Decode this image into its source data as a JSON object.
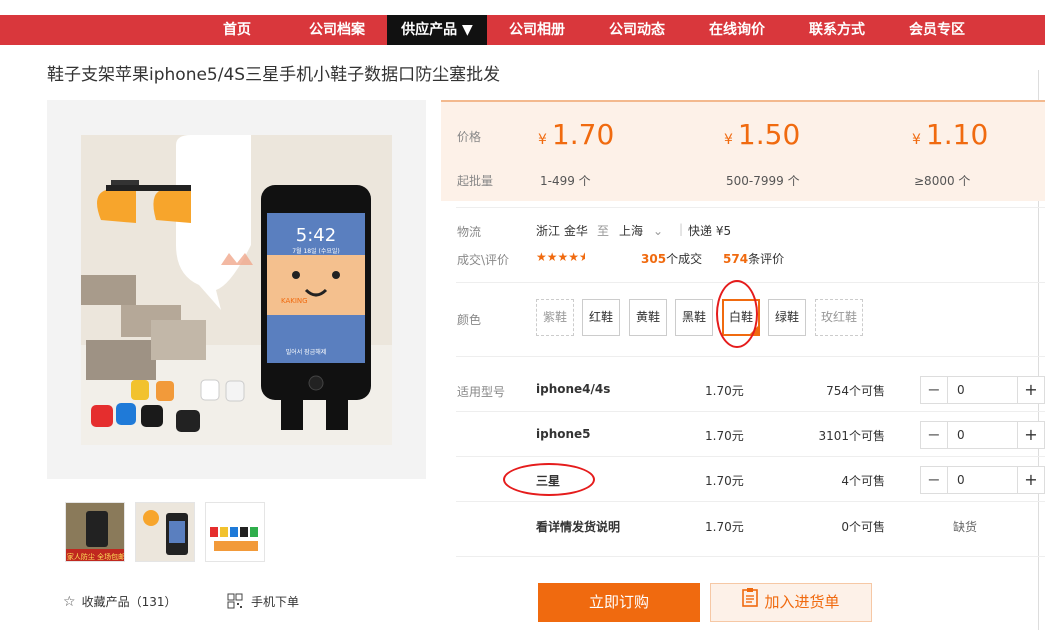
{
  "nav": {
    "items": [
      "首页",
      "公司档案",
      "供应产品 ▼",
      "公司相册",
      "公司动态",
      "在线询价",
      "联系方式",
      "会员专区"
    ]
  },
  "title": "鞋子支架苹果iphone5/4S三星手机小鞋子数据口防尘塞批发",
  "gallery": {
    "phone_time": "5:42",
    "phone_date": "7월 18일 (수요일)",
    "phone_slider": "밀어서 잠금해제",
    "watermark": "KAKING"
  },
  "thumb_caption": "家人防尘 全场包邮",
  "favorite": {
    "label": "收藏产品（131）"
  },
  "mobile_order": {
    "label": "手机下单"
  },
  "price": {
    "label": "价格",
    "qty_label": "起批量",
    "currency": "¥",
    "tiers": [
      {
        "price": "1.70",
        "qty": "1-499 个"
      },
      {
        "price": "1.50",
        "qty": "500-7999 个"
      },
      {
        "price": "1.10",
        "qty": "≥8000 个"
      }
    ]
  },
  "logistics": {
    "label": "物流",
    "from": "浙江 金华",
    "to_word": "至",
    "to": "上海",
    "express": "快递 ¥5"
  },
  "rating": {
    "label": "成交\\评价",
    "deals_num": "305",
    "deals_unit": "个成交",
    "reviews_num": "574",
    "reviews_unit": "条评价"
  },
  "colors": {
    "label": "颜色",
    "options": [
      {
        "name": "紫鞋",
        "state": "disabled"
      },
      {
        "name": "红鞋",
        "state": "normal"
      },
      {
        "name": "黄鞋",
        "state": "normal"
      },
      {
        "name": "黑鞋",
        "state": "normal"
      },
      {
        "name": "白鞋",
        "state": "selected"
      },
      {
        "name": "绿鞋",
        "state": "normal"
      },
      {
        "name": "玫红鞋",
        "state": "disabled"
      }
    ]
  },
  "models": {
    "label": "适用型号",
    "rows": [
      {
        "name": "iphone4/4s",
        "price": "1.70元",
        "stock": "754个可售",
        "qty": "0"
      },
      {
        "name": "iphone5",
        "price": "1.70元",
        "stock": "3101个可售",
        "qty": "0"
      },
      {
        "name": "三星",
        "price": "1.70元",
        "stock": "4个可售",
        "qty": "0"
      },
      {
        "name": "看详情发货说明",
        "price": "1.70元",
        "stock": "0个可售",
        "soldout": "缺货"
      }
    ]
  },
  "actions": {
    "buy": "立即订购",
    "cart": "加入进货单"
  },
  "accent_color": "#f06a0f",
  "nav_color": "#d9373c"
}
